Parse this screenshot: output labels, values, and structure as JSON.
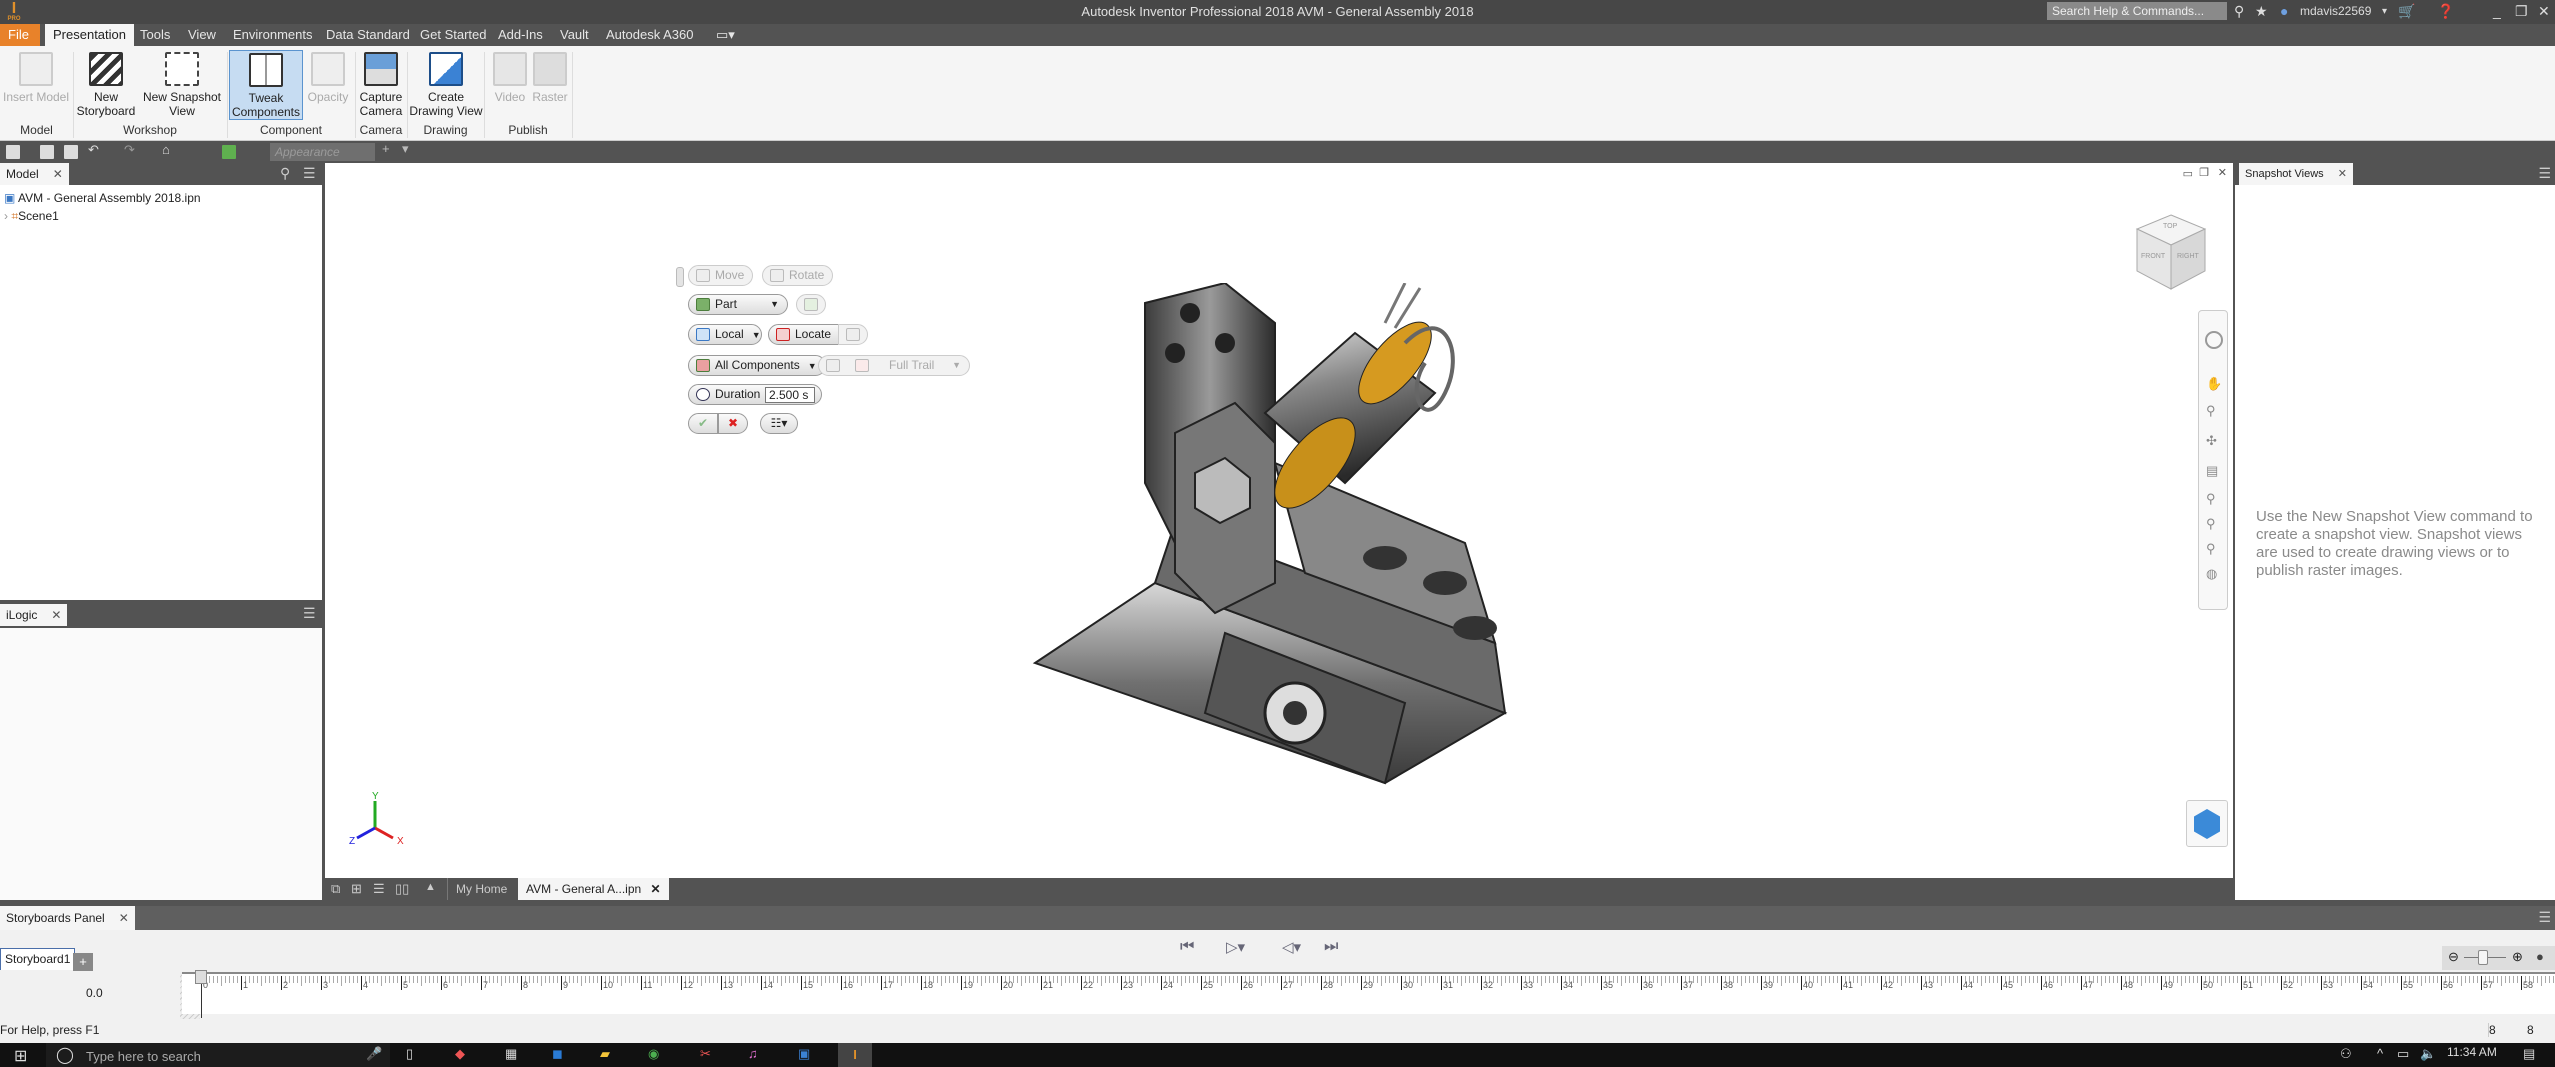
{
  "window": {
    "title": "Autodesk Inventor Professional 2018    AVM - General Assembly  2018",
    "logo": "I",
    "logo_sub": "PRO"
  },
  "title_right": {
    "search_placeholder": "Search Help & Commands...",
    "user": "mdavis22569"
  },
  "ribbon_tabs": [
    "File",
    "Presentation",
    "Tools",
    "View",
    "Environments",
    "Data Standard",
    "Get Started",
    "Add-Ins",
    "Vault",
    "Autodesk A360"
  ],
  "active_tab": "Presentation",
  "ribbon": {
    "buttons": [
      {
        "label": "Insert Model",
        "enabled": false,
        "icon": "insert-model-icon"
      },
      {
        "label": "New Storyboard",
        "enabled": true,
        "icon": "clapperboard-icon"
      },
      {
        "label": "New Snapshot View",
        "enabled": true,
        "icon": "snapshot-view-icon"
      },
      {
        "label": "Tweak Components",
        "enabled": true,
        "selected": true,
        "icon": "tweak-components-icon"
      },
      {
        "label": "Opacity",
        "enabled": false,
        "icon": "opacity-icon"
      },
      {
        "label": "Capture Camera",
        "enabled": true,
        "icon": "camera-icon"
      },
      {
        "label": "Create Drawing View",
        "enabled": true,
        "icon": "drawing-view-icon"
      },
      {
        "label": "Video",
        "enabled": false,
        "icon": "video-icon"
      },
      {
        "label": "Raster",
        "enabled": false,
        "icon": "raster-icon"
      }
    ],
    "groups": [
      "Model",
      "Workshop",
      "Component",
      "Camera",
      "Drawing",
      "Publish"
    ]
  },
  "quick_access": {
    "appearance_placeholder": "Appearance"
  },
  "model_panel": {
    "tab": "Model",
    "root": "AVM - General Assembly  2018.ipn",
    "children": [
      "Scene1"
    ]
  },
  "ilogic_panel": {
    "tab": "iLogic"
  },
  "mini_toolbar": {
    "move": "Move",
    "rotate": "Rotate",
    "selection": "Part",
    "coord": "Local",
    "locate": "Locate",
    "components": "All Components",
    "trail": "Full Trail",
    "duration_label": "Duration",
    "duration_value": "2.500 s"
  },
  "viewcube": {
    "top": "TOP",
    "front": "FRONT",
    "right": "RIGHT"
  },
  "axes": {
    "x": "X",
    "y": "Y",
    "z": "Z"
  },
  "doc_tabs": [
    "My Home",
    "AVM - General A...ipn"
  ],
  "snapshot_panel": {
    "tab": "Snapshot Views",
    "help": "Use the New Snapshot View command to create a snapshot view. Snapshot views are used to create drawing views or to publish raster images."
  },
  "storyboards": {
    "panel_title": "Storyboards Panel",
    "tab": "Storyboard1",
    "current_time": "0.0",
    "ruler_min": 0,
    "ruler_max": 58
  },
  "status": {
    "help": "For Help, press F1",
    "count1": "8",
    "count2": "8"
  },
  "taskbar": {
    "search_placeholder": "Type here to search",
    "time": "11:34 AM"
  },
  "colors": {
    "file_tab": "#e8822a",
    "selected_button": "#c6dcf2",
    "dark_chrome": "#535353"
  }
}
